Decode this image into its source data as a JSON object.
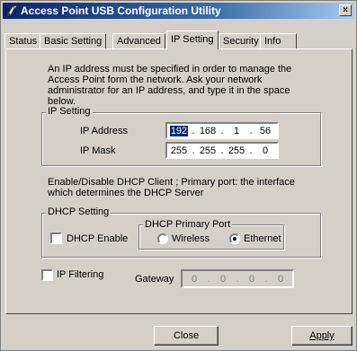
{
  "window": {
    "title": "Access Point USB Configuration Utility",
    "close_glyph": "×"
  },
  "tabs": [
    {
      "label": "Status"
    },
    {
      "label": "Basic Setting"
    },
    {
      "label": "Advanced"
    },
    {
      "label": "IP Setting",
      "active": true
    },
    {
      "label": "Security"
    },
    {
      "label": "Info"
    }
  ],
  "intro_text": "An IP address must be specified in order to manage the Access Point form the network. Ask your network administrator for an IP address, and type it in the space below.",
  "ip_setting": {
    "group_label": "IP Setting",
    "ip_address_label": "IP Address",
    "ip_address": [
      "192",
      "168",
      "1",
      "56"
    ],
    "ip_mask_label": "IP Mask",
    "ip_mask": [
      "255",
      "255",
      "255",
      "0"
    ],
    "separator": "."
  },
  "dhcp_note": "Enable/Disable DHCP Client ; Primary port: the interface which determines the DHCP Server",
  "dhcp": {
    "group_label": "DHCP Setting",
    "enable_label": "DHCP Enable",
    "enable_checked": false,
    "primary_port_label": "DHCP Primary Port",
    "wireless_label": "Wireless",
    "ethernet_label": "Ethernet",
    "selected": "Ethernet"
  },
  "ip_filtering": {
    "label": "IP Filtering",
    "checked": false
  },
  "gateway": {
    "label": "Gateway",
    "value": [
      "0",
      "0",
      "0",
      "0"
    ]
  },
  "buttons": {
    "close": "Close",
    "apply": "Apply"
  }
}
